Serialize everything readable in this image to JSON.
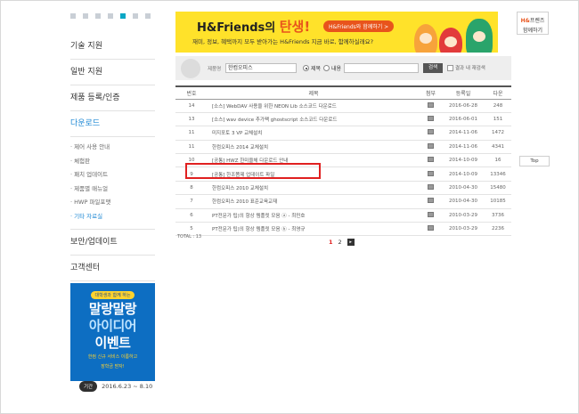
{
  "sidebar": {
    "main_items": [
      {
        "label": "기술 지원"
      },
      {
        "label": "일반 지원"
      },
      {
        "label": "제품 등록/인증"
      },
      {
        "label": "다운로드"
      }
    ],
    "sub_items": [
      {
        "label": "제어 사용 안내"
      },
      {
        "label": "체험판"
      },
      {
        "label": "패치 업데이트"
      },
      {
        "label": "제품별 매뉴얼"
      },
      {
        "label": "HWP 파일포맷"
      },
      {
        "label": "기타 자료실"
      }
    ],
    "bottom_items": [
      {
        "label": "보안/업데이트"
      },
      {
        "label": "고객센터"
      }
    ]
  },
  "promo": {
    "tag": "대학생과 함께 하는",
    "line1": "말랑말랑",
    "line2": "아이디어",
    "line3": "이벤트",
    "desc1": "한컴 신규 서비스 이름하고",
    "desc2": "장학금 받자!",
    "period_badge": "기간",
    "period": "2016.6.23 ~ 8.10"
  },
  "banner": {
    "title_prefix": "H&Friends의",
    "title_accent": "탄생!",
    "cta": "H&Friends와 함께하기 >",
    "subtitle": "재미, 정보, 혜택까지 모두 받아가는 H&Friends 지금 바로, 함께하실래요?"
  },
  "quick_box": {
    "brand_h": "H&",
    "brand_rest": "프렌즈",
    "action": "함께하기"
  },
  "top_button": "Top",
  "search": {
    "label": "제품명",
    "category": "한컴오피스",
    "radio_title": "제목",
    "radio_content": "내용",
    "input_value": "",
    "button": "검색",
    "within": "결과 내 재검색"
  },
  "table": {
    "headers": [
      "번호",
      "제목",
      "첨부",
      "등록일",
      "다운"
    ],
    "rows": [
      {
        "no": "14",
        "title": "[소스] WebDAV 사용을 위한 NEON Lib 소스코드 다운로드",
        "date": "2016-06-28",
        "down": "248"
      },
      {
        "no": "13",
        "title": "[소스] wav device 추가팩 ghostscript 소스코드 다운로드",
        "date": "2016-06-01",
        "down": "151"
      },
      {
        "no": "11",
        "title": "미지포토 3 VP 교체설치",
        "date": "2014-11-06",
        "down": "1472"
      },
      {
        "no": "11",
        "title": "한컴오피스 2014 교체설치",
        "date": "2014-11-06",
        "down": "4341"
      },
      {
        "no": "10",
        "title": "[공통] HWZ 한미을체 다운로드 안내",
        "date": "2014-10-09",
        "down": "16"
      },
      {
        "no": "9",
        "title": "[공통] 한조쯤제 업데이트 파일",
        "date": "2014-10-09",
        "down": "13346"
      },
      {
        "no": "8",
        "title": "한컴오피스 2010 교체설치",
        "date": "2010-04-30",
        "down": "15480"
      },
      {
        "no": "7",
        "title": "한컴오피스 2010 표준교육교재",
        "date": "2010-04-30",
        "down": "10185"
      },
      {
        "no": "6",
        "title": "PT전문가 팁)의 항상 템플릿 모음 ⓐ - 최민호",
        "date": "2010-03-29",
        "down": "3736"
      },
      {
        "no": "5",
        "title": "PT전문가 팁)의 항상 템플릿 모음 ⓑ - 최영규",
        "date": "2010-03-29",
        "down": "2236"
      }
    ]
  },
  "total": "TOTAL : 13",
  "pager": {
    "pages": [
      "1",
      "2"
    ],
    "current": "1",
    "next": "▸"
  },
  "colors": {
    "accent": "#1e88d4",
    "banner_bg": "#ffe22a",
    "highlight": "#e02020",
    "promo_bg": "#0d6ec2"
  }
}
